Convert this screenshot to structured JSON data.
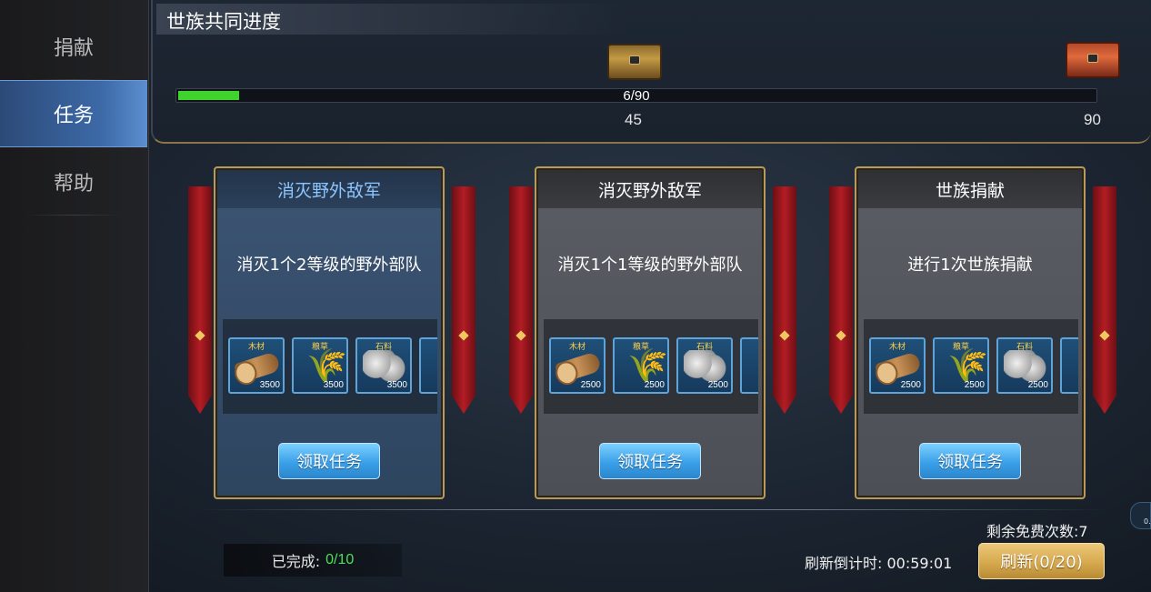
{
  "sidebar": {
    "items": [
      {
        "label": "捐献",
        "active": false
      },
      {
        "label": "任务",
        "active": true
      },
      {
        "label": "帮助",
        "active": false
      }
    ]
  },
  "progress": {
    "title": "世族共同进度",
    "current": 6,
    "max": 90,
    "text": "6/90",
    "milestones": [
      {
        "value": "45",
        "chest": "wooden-chest-icon"
      },
      {
        "value": "90",
        "chest": "red-chest-icon"
      }
    ],
    "fill_color": "#3fd32e"
  },
  "tasks": [
    {
      "title": "消灭野外敌军",
      "description": "消灭1个2等级的野外部队",
      "style": "blue",
      "rewards": [
        {
          "label": "木材",
          "amount": "3500",
          "icon": "wood-icon"
        },
        {
          "label": "粮草",
          "amount": "3500",
          "icon": "grain-icon"
        },
        {
          "label": "石料",
          "amount": "3500",
          "icon": "stone-icon"
        }
      ],
      "button": "领取任务"
    },
    {
      "title": "消灭野外敌军",
      "description": "消灭1个1等级的野外部队",
      "style": "gray",
      "rewards": [
        {
          "label": "木材",
          "amount": "2500",
          "icon": "wood-icon"
        },
        {
          "label": "粮草",
          "amount": "2500",
          "icon": "grain-icon"
        },
        {
          "label": "石料",
          "amount": "2500",
          "icon": "stone-icon"
        }
      ],
      "button": "领取任务"
    },
    {
      "title": "世族捐献",
      "description": "进行1次世族捐献",
      "style": "gray",
      "rewards": [
        {
          "label": "木材",
          "amount": "2500",
          "icon": "wood-icon"
        },
        {
          "label": "粮草",
          "amount": "2500",
          "icon": "grain-icon"
        },
        {
          "label": "石料",
          "amount": "2500",
          "icon": "stone-icon"
        }
      ],
      "button": "领取任务"
    }
  ],
  "footer": {
    "completed_label": "已完成:",
    "completed_value": "0/10",
    "free_count": "剩余免费次数:7",
    "refresh_timer": "刷新倒计时: 00:59:01",
    "refresh_button": "刷新(0/20)",
    "edge_text": "0."
  }
}
